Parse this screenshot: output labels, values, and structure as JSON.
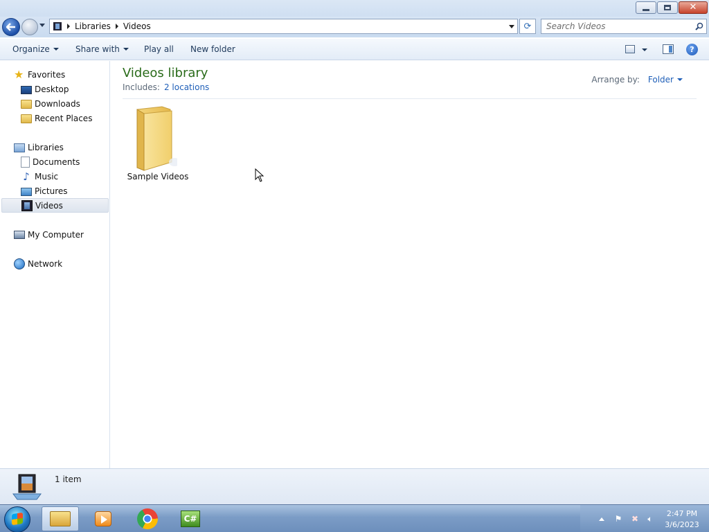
{
  "window": {
    "caption_buttons": [
      "minimize",
      "maximize",
      "close"
    ]
  },
  "address": {
    "crumbs": [
      "Libraries",
      "Videos"
    ],
    "search_placeholder": "Search Videos"
  },
  "toolbar": {
    "organize": "Organize",
    "share_with": "Share with",
    "play_all": "Play all",
    "new_folder": "New folder"
  },
  "nav": {
    "favorites": "Favorites",
    "favorites_items": [
      "Desktop",
      "Downloads",
      "Recent Places"
    ],
    "libraries": "Libraries",
    "libraries_items": [
      "Documents",
      "Music",
      "Pictures",
      "Videos"
    ],
    "selected": "Videos",
    "computer": "My Computer",
    "network": "Network"
  },
  "content": {
    "title": "Videos library",
    "includes_label": "Includes:",
    "includes_link": "2 locations",
    "arrange_label": "Arrange by:",
    "arrange_value": "Folder",
    "items": [
      {
        "name": "Sample Videos",
        "icon": "folder-icon"
      }
    ]
  },
  "details": {
    "count": "1 item"
  },
  "taskbar": {
    "apps": [
      "windows-explorer-icon",
      "media-player-icon",
      "chrome-icon",
      "csharp-express-icon"
    ],
    "clock_time": "2:47 PM",
    "clock_date": "3/6/2023"
  },
  "colors": {
    "accent": "#1f5fb8",
    "library_title": "#2a6b1a",
    "taskbar": "#7b9cc6"
  }
}
